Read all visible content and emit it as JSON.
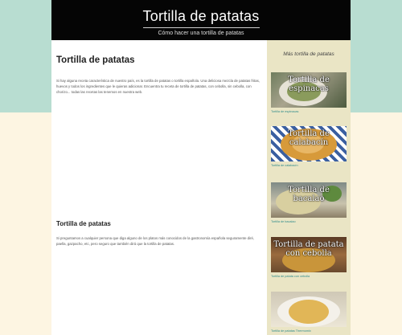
{
  "header": {
    "title": "Tortilla de patatas",
    "subtitle": "Cómo hacer una tortilla de patatas"
  },
  "main": {
    "heading": "Tortilla de patatas",
    "intro": "Si hay alguna receta característica de nuestro país, es la tortilla de patatas o tortilla española. Una deliciosa mezcla de patatas fritas, huevos y todos los ingredientes que le quieras adicionar. Encuentra tu receta de tortilla de patatas, con cebolla, sin cebolla, con chorizo... todas las recetas las tenemos en nuestra web.",
    "section_heading": "Tortilla de patatas",
    "section_text": "Si preguntamos a cualquier persona que diga alguno de los platos más conocidos de la gastronomía española seguramente diré, paella, gazpacho, etc, pero seguro que también dirá que la tortilla de patatas."
  },
  "sidebar": {
    "title": "Más tortilla de patatas",
    "items": [
      {
        "overlay": "Tortilla de espinacas",
        "caption": "Tortilla de espinacas"
      },
      {
        "overlay": "Tortilla de calabacín",
        "caption": "Tortilla de calabacín"
      },
      {
        "overlay": "Tortilla de bacalao",
        "caption": "Tortilla de bacalao"
      },
      {
        "overlay": "Tortilla de patata con cebolla",
        "caption": "Tortilla de patata con cebolla"
      },
      {
        "overlay": "",
        "caption": "Tortilla de patatas Thermomix"
      }
    ]
  },
  "colors": {
    "background_top": "#b8ddd1",
    "background_bottom": "#fdf5e2",
    "header": "#050505",
    "sidebar": "#eae5c5",
    "link": "#2e8b8b"
  }
}
